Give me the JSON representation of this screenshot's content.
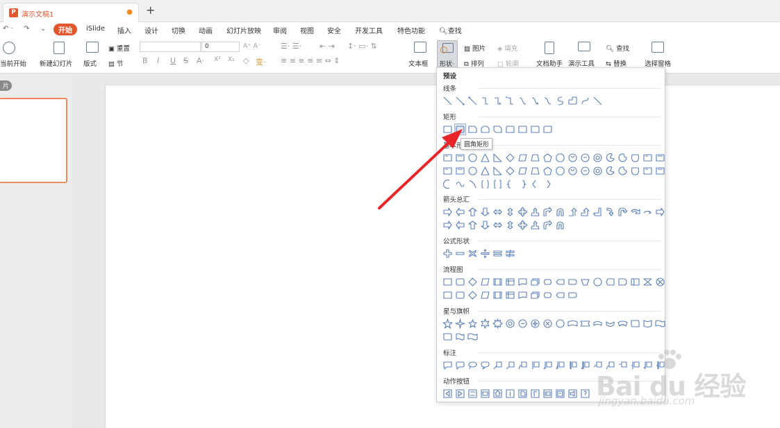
{
  "tab": {
    "title": "演示文稿1",
    "new_tab": "+",
    "logo": "P"
  },
  "quick_access": {
    "undo": "↶ ·",
    "redo": "↷",
    "more": "⌄"
  },
  "menu": {
    "start": "开始",
    "items": [
      "iSlide",
      "插入",
      "设计",
      "切换",
      "动画",
      "幻灯片放映",
      "审阅",
      "视图",
      "安全",
      "开发工具",
      "特色功能"
    ],
    "search": "查找"
  },
  "ribbon": {
    "play_from_current": "当前开始",
    "new_slide": "新建幻灯片",
    "layout": "版式",
    "section": "节",
    "reset": "重置",
    "font_size": "0",
    "textbox": "文本框",
    "shape": "形状",
    "picture": "图片",
    "fill": "填充",
    "arrange": "排列",
    "outline": "轮廓",
    "doc_assistant": "文档助手",
    "present_tools": "演示工具",
    "find": "查找",
    "replace": "替换",
    "selection_pane": "选择窗格"
  },
  "thumbs_label": "片",
  "shapes_panel": {
    "preset": "预设",
    "sections": {
      "lines": "线条",
      "rect": "矩形",
      "basic": "基本形状",
      "arrows": "箭头总汇",
      "equation": "公式形状",
      "flowchart": "流程图",
      "stars": "星与旗帜",
      "callouts": "标注",
      "action": "动作按钮"
    }
  },
  "tooltip": "圆角矩形",
  "watermark": {
    "brand": "Bai du 经验",
    "url": "jingyan.baidu.com"
  },
  "colors": {
    "accent": "#e4572e",
    "shape_stroke": "#5b7fb8",
    "arrow": "#e8262a"
  }
}
